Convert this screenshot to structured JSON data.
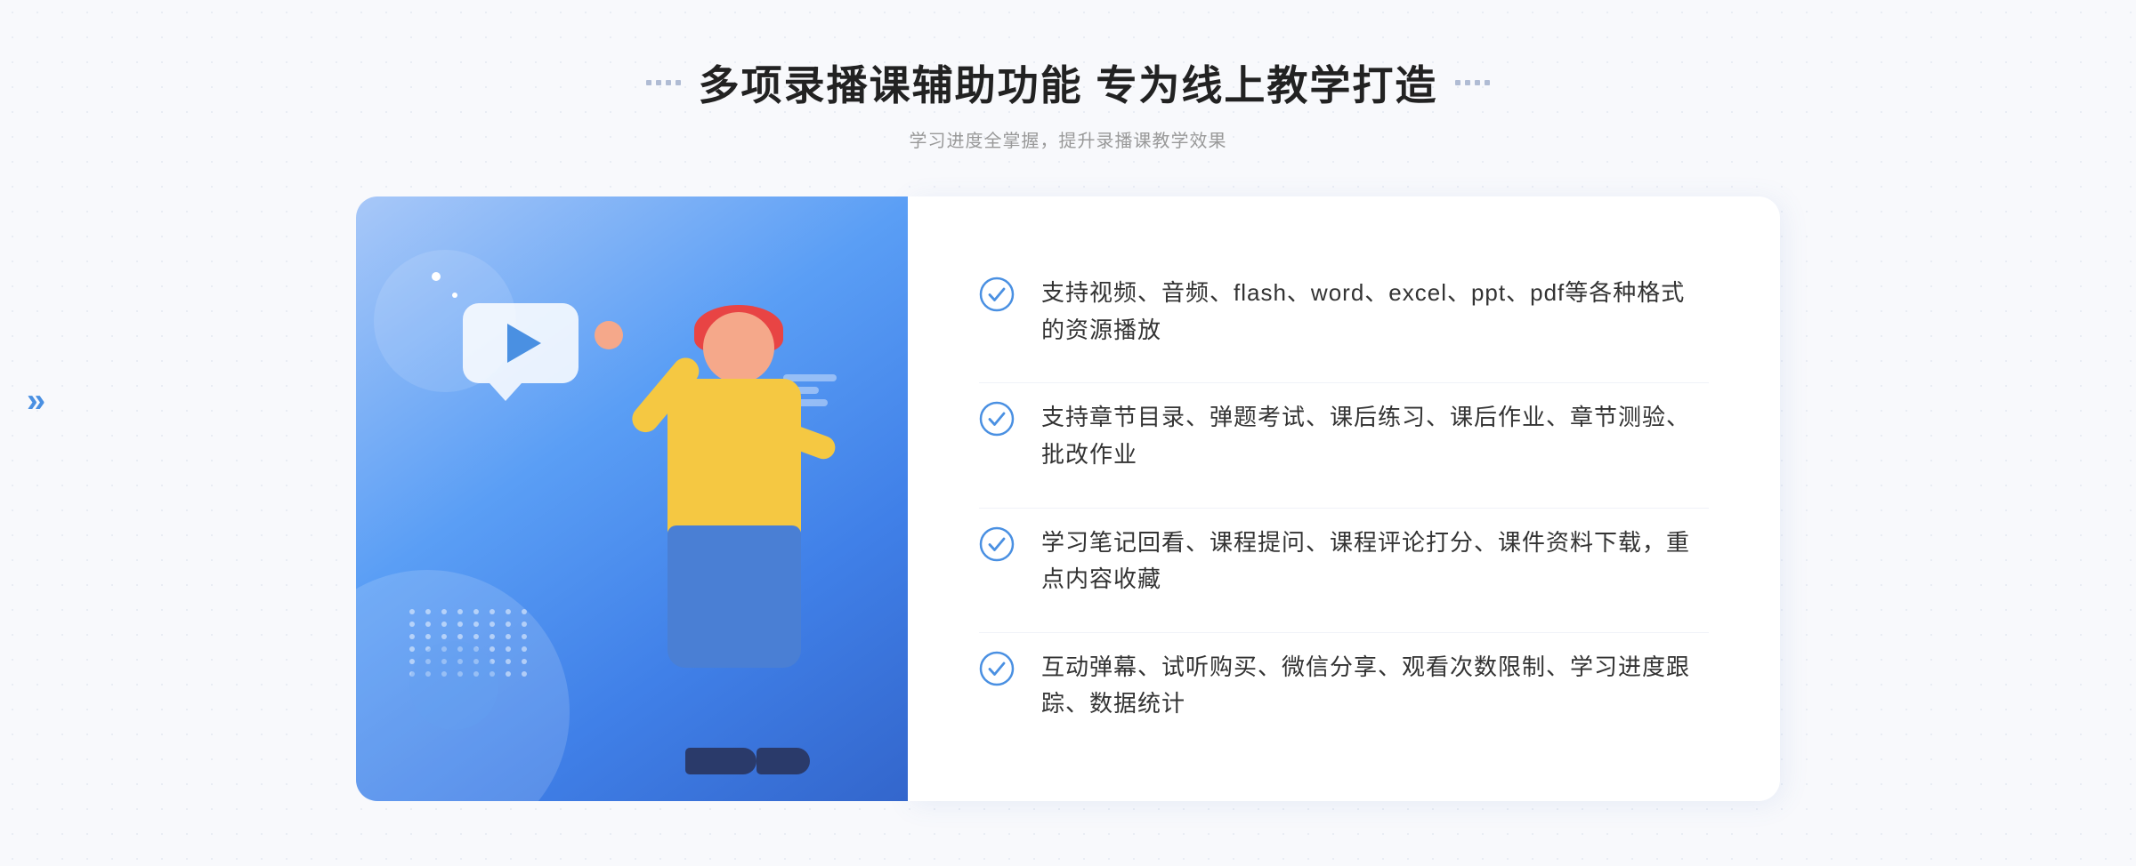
{
  "header": {
    "title": "多项录播课辅助功能 专为线上教学打造",
    "subtitle": "学习进度全掌握，提升录播课教学效果"
  },
  "features": [
    {
      "id": "feature-1",
      "text": "支持视频、音频、flash、word、excel、ppt、pdf等各种格式的资源播放"
    },
    {
      "id": "feature-2",
      "text": "支持章节目录、弹题考试、课后练习、课后作业、章节测验、批改作业"
    },
    {
      "id": "feature-3",
      "text": "学习笔记回看、课程提问、课程评论打分、课件资料下载，重点内容收藏"
    },
    {
      "id": "feature-4",
      "text": "互动弹幕、试听购买、微信分享、观看次数限制、学习进度跟踪、数据统计"
    }
  ],
  "decorations": {
    "left_chevron": "»",
    "check_color": "#4a90e2"
  }
}
